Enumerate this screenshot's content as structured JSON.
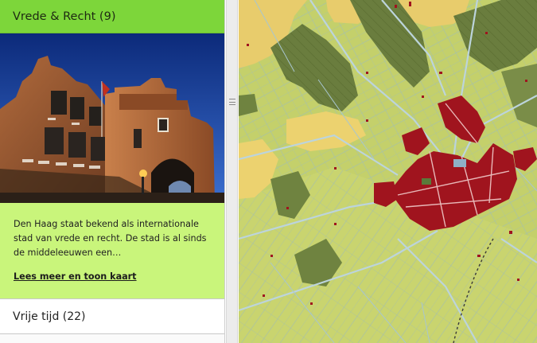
{
  "sidebar": {
    "active_category": {
      "label": "Vrede & Recht (9)",
      "photo_icon": "castle-gate-photo",
      "excerpt": "Den Haag staat bekend als internationale stad van vrede en recht. De stad is al sinds de middeleeuwen een…",
      "read_more": "Lees meer en toon kaart"
    },
    "categories": [
      {
        "label": "Vrije tijd (22)"
      },
      {
        "label": ""
      }
    ]
  },
  "scrollbar": {
    "icon": "grip-icon"
  },
  "map": {
    "icon": "historic-map",
    "colors": {
      "water": "#bcd4dc",
      "urban": "#a0141e",
      "field": "#c4d06b",
      "forest": "#687c3e",
      "dune": "#e8cc6c"
    }
  }
}
